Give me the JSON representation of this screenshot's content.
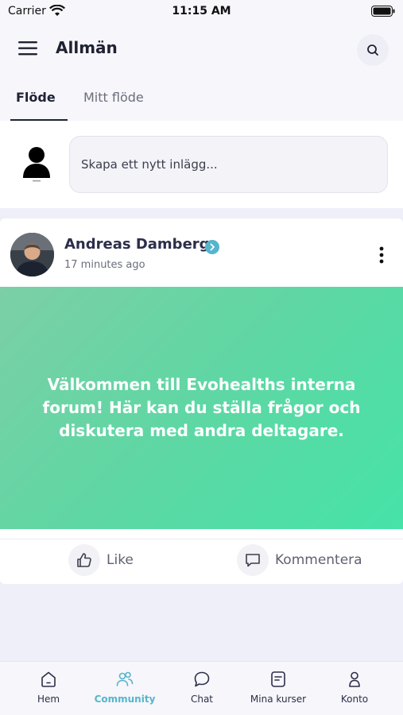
{
  "status_bar": {
    "carrier": "Carrier",
    "time": "11:15 AM"
  },
  "header": {
    "title": "Allmän"
  },
  "tabs": [
    {
      "label": "Flöde",
      "active": true
    },
    {
      "label": "Mitt flöde",
      "active": false
    }
  ],
  "composer": {
    "placeholder": "Skapa ett nytt inlägg..."
  },
  "post": {
    "author": "Andreas Damberg",
    "time": "17 minutes ago",
    "text": "Välkommen till Evohealths interna forum! Här kan du ställa frågor och diskutera med andra deltagare.",
    "like_label": "Like",
    "comment_label": "Kommentera"
  },
  "nav": {
    "items": [
      {
        "label": "Hem",
        "icon": "home-icon"
      },
      {
        "label": "Community",
        "icon": "community-icon",
        "active": true
      },
      {
        "label": "Chat",
        "icon": "chat-icon"
      },
      {
        "label": "Mina kurser",
        "icon": "courses-icon"
      },
      {
        "label": "Konto",
        "icon": "account-icon"
      }
    ]
  },
  "colors": {
    "accent": "#56b5cc",
    "banner_start": "#7ccfa6",
    "banner_end": "#46e3a8",
    "verified": "#56b5cc"
  }
}
